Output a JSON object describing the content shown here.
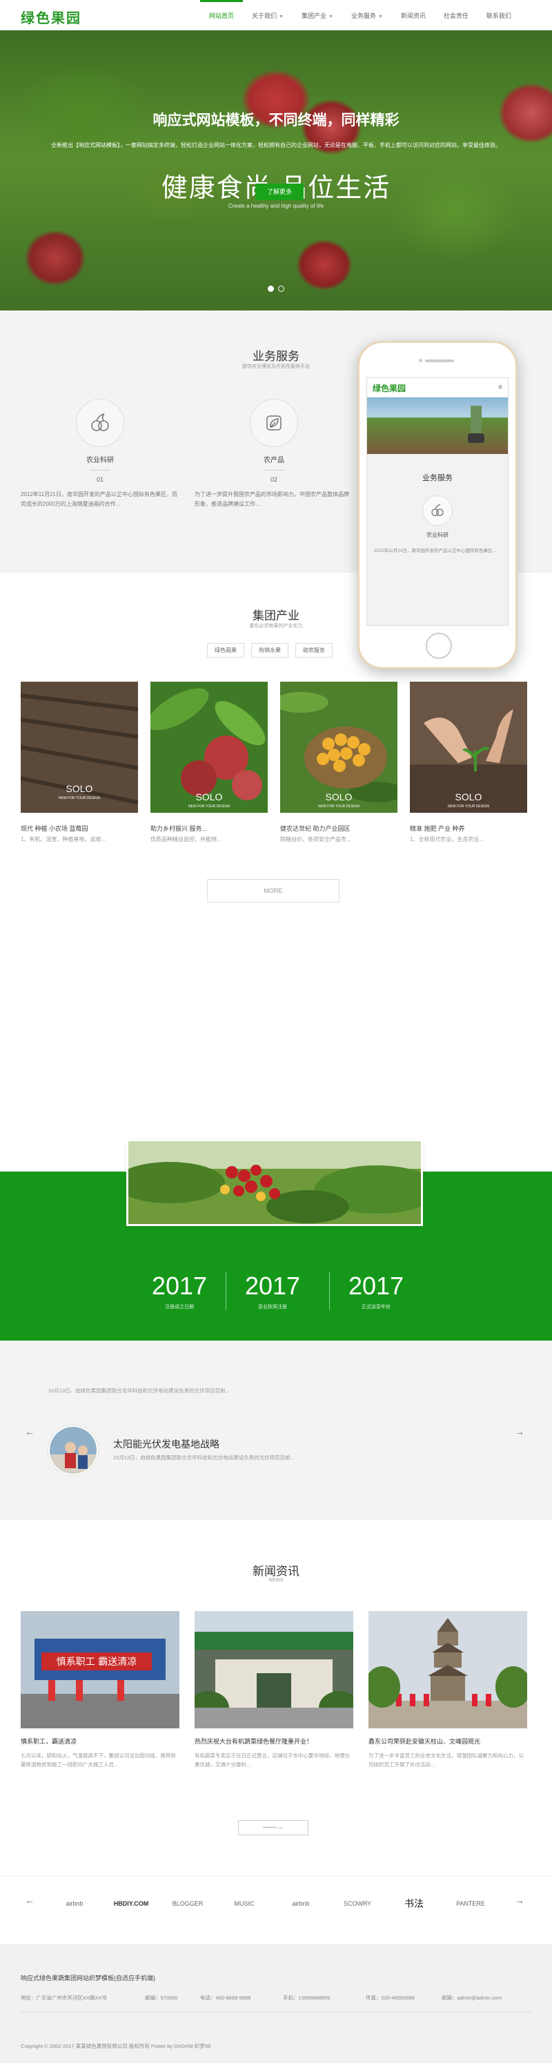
{
  "header": {
    "logo": "绿色果园",
    "nav": [
      {
        "label": "网站首页",
        "active": true,
        "caret": false
      },
      {
        "label": "关于我们",
        "active": false,
        "caret": true
      },
      {
        "label": "集团产业",
        "active": false,
        "caret": true
      },
      {
        "label": "业务服务",
        "active": false,
        "caret": true
      },
      {
        "label": "新闻资讯",
        "active": false,
        "caret": false
      },
      {
        "label": "社会责任",
        "active": false,
        "caret": false
      },
      {
        "label": "联系我们",
        "active": false,
        "caret": false
      }
    ]
  },
  "hero": {
    "headline": "响应式网站模板，不同终端，同样精彩",
    "intro": "全新推出【响应式网站模板】，一套网站搞定多终端，轻松打造企业网站一体化方案，轻松拥有自己的企业网站，无论是在电脑、平板、手机上都可以访问到对应的网站，享受最佳体验。",
    "slogan": "健康食尚 品位生活",
    "sub": "Create a healthy and high quality of life",
    "button": "了解更多"
  },
  "services": {
    "title": "业务服务",
    "subtitle": "提供农业博览及开拓性服务平台",
    "items": [
      {
        "name": "农业科研",
        "no": "01",
        "desc": "2012年11月21日，南华园开发的产品以芷中心国际有色果区，而完成长的2000万的上海锦夏迪画的合作..."
      },
      {
        "name": "农产品",
        "no": "02",
        "desc": "为了进一步提升我国农产品的市场影响力，中国农产品整体品牌形象，推进品牌建设工作..."
      }
    ]
  },
  "phone": {
    "logo": "绿色果园",
    "title": "业务服务",
    "item": "农业科研",
    "desc": "2012年11月21日，南华园开发的产品以芷中心国际有色果区..."
  },
  "group": {
    "title": "集团产业",
    "subtitle": "重在必须有果的产业实力",
    "tabs": [
      "绿色蔬果",
      "热销水果",
      "助农服务"
    ],
    "cards": [
      {
        "title": "现代 种植 小农场 蓝莓园",
        "desc": "1、有机、温室、种植基地，追坡...",
        "label": "SOLO",
        "sub": "NEW FOR YOUR DESIGN"
      },
      {
        "title": "助力乡村振兴 服务...",
        "desc": "优质品种精益监控，并能随...",
        "label": "SOLO",
        "sub": "NEW FOR YOUR DESIGN"
      },
      {
        "title": "健农达世纪 助力产业园区",
        "desc": "院精益价，各项安全产品专...",
        "label": "SOLO",
        "sub": "NEW FOR YOUR DESIGN"
      },
      {
        "title": "精准 施肥 产业 种养",
        "desc": "1、全新现代农业，生态农业...",
        "label": "SOLO",
        "sub": "NEW FOR YOUR DESIGN"
      }
    ],
    "more": "MORE"
  },
  "stats": [
    {
      "num": "2017",
      "label": "注册成立日期"
    },
    {
      "num": "2017",
      "label": "营业执照注册"
    },
    {
      "num": "2017",
      "label": "正式运营年份"
    }
  ],
  "slider": {
    "top_text": "10月13日，由绿色果园集团联合龙华科技和光伏电站建设负责的光伏项目目前...",
    "title": "太阳能光伏发电基地战略",
    "desc": "10月13日，由绿色果园集团联合龙华科技和光伏电站建设负责的光伏项目目前..."
  },
  "news": {
    "title": "新闻资讯",
    "subtitle": "NEWS",
    "items": [
      {
        "title": "慎系职工，霸送清凉",
        "desc": "七月以来，骄阳似火，气温居高不下，集团公司派出慰问组，携带防暑降温物资到施工一线慰问广大施工人员..."
      },
      {
        "title": "热烈庆祝大台有机蔬菜绿色餐厅隆重开业！",
        "desc": "有机蔬菜专卖店于近日正式营业，店铺位于市中心繁华地段，地理位置优越，交通十分便利..."
      },
      {
        "title": "鑫东公司荣获赴安徽天柱山、文峰园观光",
        "desc": "为了进一步丰富员工的业余文化生活，增强团队凝聚力和向心力，公司组织员工开展了外出活动..."
      }
    ],
    "more": "——→"
  },
  "partners": [
    "airbnb",
    "HBDIY.COM",
    "BLOGGER",
    "MUSIC",
    "airbnb",
    "SCOWRY",
    "书法",
    "PANTERE"
  ],
  "footer": {
    "title": "响应式绿色果蔬集团网站织梦模板(自适应手机端)",
    "address": "地址：广东省广州市天河区XX路XX号",
    "post": "邮编：570000",
    "phone": "电话：400-8899-9988",
    "mobile": "手机：13899888899",
    "fax": "传真：020-46565688",
    "email": "邮箱：admin@admin.com",
    "copyright": "Copyright © 2002-2017 某某绿色果园有限公司 版权所有 Power by DeDe58 织梦58"
  },
  "colors": {
    "brand_green": "#1a9e1a",
    "band_green": "#15981a"
  }
}
